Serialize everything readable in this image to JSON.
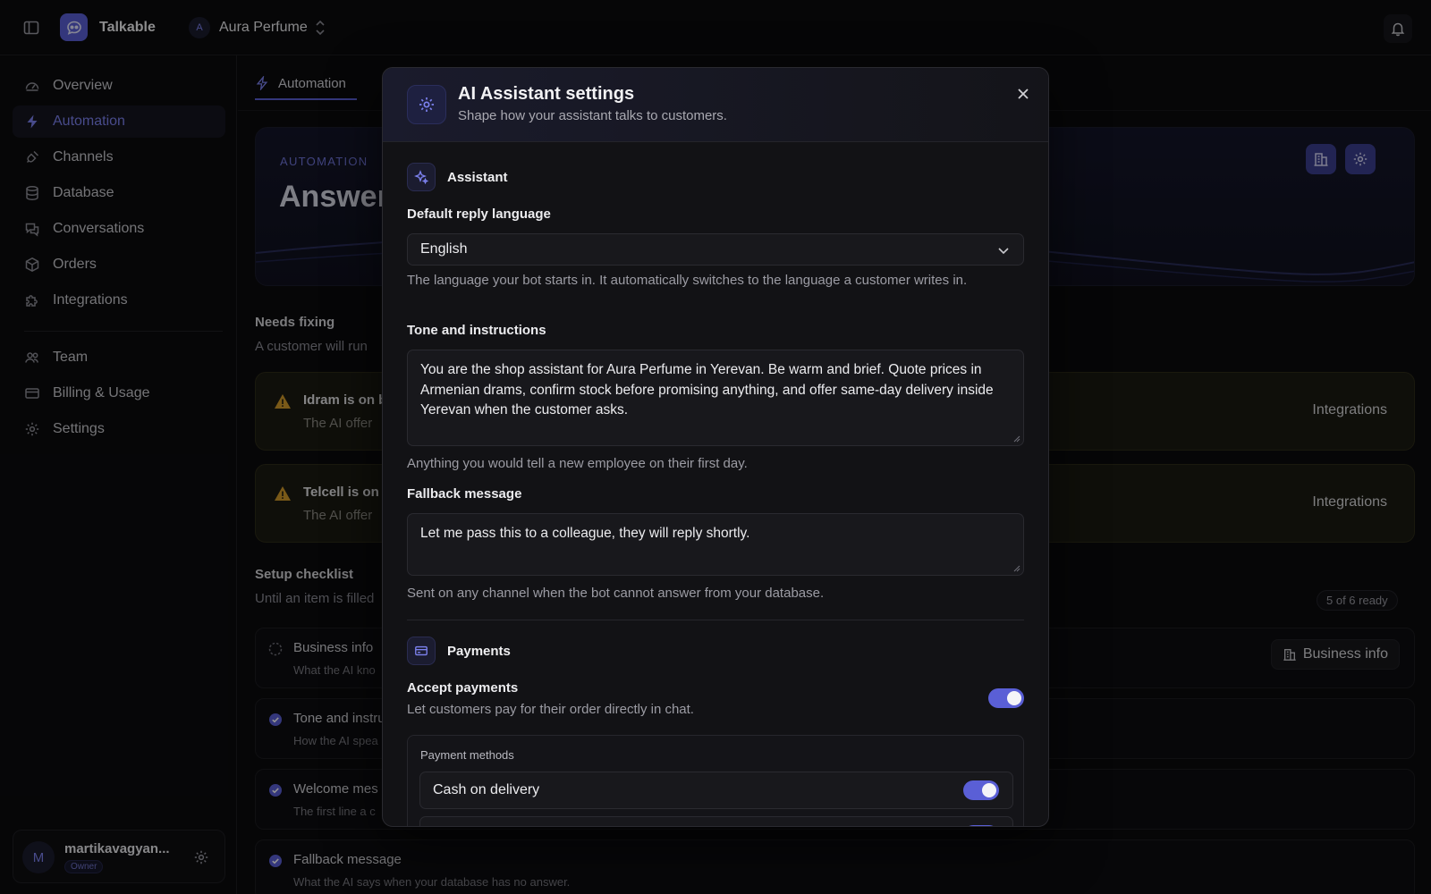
{
  "topbar": {
    "app_name": "Talkable",
    "workspace_initial": "A",
    "workspace_name": "Aura Perfume"
  },
  "sidebar": {
    "items": [
      {
        "label": "Overview",
        "icon": "gauge-icon"
      },
      {
        "label": "Automation",
        "icon": "lightning-icon",
        "active": true
      },
      {
        "label": "Channels",
        "icon": "plug-icon"
      },
      {
        "label": "Database",
        "icon": "database-icon"
      },
      {
        "label": "Conversations",
        "icon": "chat-icon"
      },
      {
        "label": "Orders",
        "icon": "box-icon"
      },
      {
        "label": "Integrations",
        "icon": "puzzle-icon"
      },
      {
        "label": "Team",
        "icon": "users-icon"
      },
      {
        "label": "Billing & Usage",
        "icon": "card-icon"
      },
      {
        "label": "Settings",
        "icon": "gear-icon"
      }
    ],
    "user": {
      "initial": "M",
      "name": "martikavagyan...",
      "role": "Owner"
    }
  },
  "main": {
    "tab_label": "Automation",
    "hero": {
      "eyebrow": "AUTOMATION",
      "headline": "Answer"
    },
    "needs_fixing": {
      "title": "Needs fixing",
      "subtitle": "A customer will run"
    },
    "alerts": [
      {
        "title": "Idram is on b",
        "body": "The AI offer",
        "link": "Integrations"
      },
      {
        "title": "Telcell is on l",
        "body": "The AI offer",
        "link": "Integrations"
      }
    ],
    "checklist": {
      "title": "Setup checklist",
      "subtitle": "Until an item is filled",
      "ready": "5 of 6 ready",
      "items": [
        {
          "title": "Business info",
          "sub": "What the AI kno",
          "done": false,
          "button": "Business info"
        },
        {
          "title": "Tone and instru",
          "sub": "How the AI spea",
          "done": true
        },
        {
          "title": "Welcome mes",
          "sub": "The first line a c",
          "done": true
        },
        {
          "title": "Fallback message",
          "sub": "What the AI says when your database has no answer.",
          "done": true
        }
      ]
    }
  },
  "modal": {
    "title": "AI Assistant settings",
    "subtitle": "Shape how your assistant talks to customers.",
    "assistant_section": "Assistant",
    "language": {
      "label": "Default reply language",
      "value": "English",
      "help": "The language your bot starts in. It automatically switches to the language a customer writes in."
    },
    "tone": {
      "label": "Tone and instructions",
      "value": "You are the shop assistant for Aura Perfume in Yerevan. Be warm and brief. Quote prices in Armenian drams, confirm stock before promising anything, and offer same-day delivery inside Yerevan when the customer asks.",
      "help": "Anything you would tell a new employee on their first day."
    },
    "fallback": {
      "label": "Fallback message",
      "value": "Let me pass this to a colleague, they will reply shortly.",
      "help": "Sent on any channel when the bot cannot answer from your database."
    },
    "payments_section": "Payments",
    "accept_payments": {
      "label": "Accept payments",
      "help": "Let customers pay for their order directly in chat.",
      "enabled": true
    },
    "payment_methods": {
      "label": "Payment methods",
      "items": [
        {
          "name": "Cash on delivery",
          "enabled": true
        },
        {
          "name": "",
          "enabled": true
        }
      ]
    }
  },
  "colors": {
    "accent": "#5a5fd6",
    "warning": "#d19a2a",
    "background": "#0b0b0d"
  }
}
